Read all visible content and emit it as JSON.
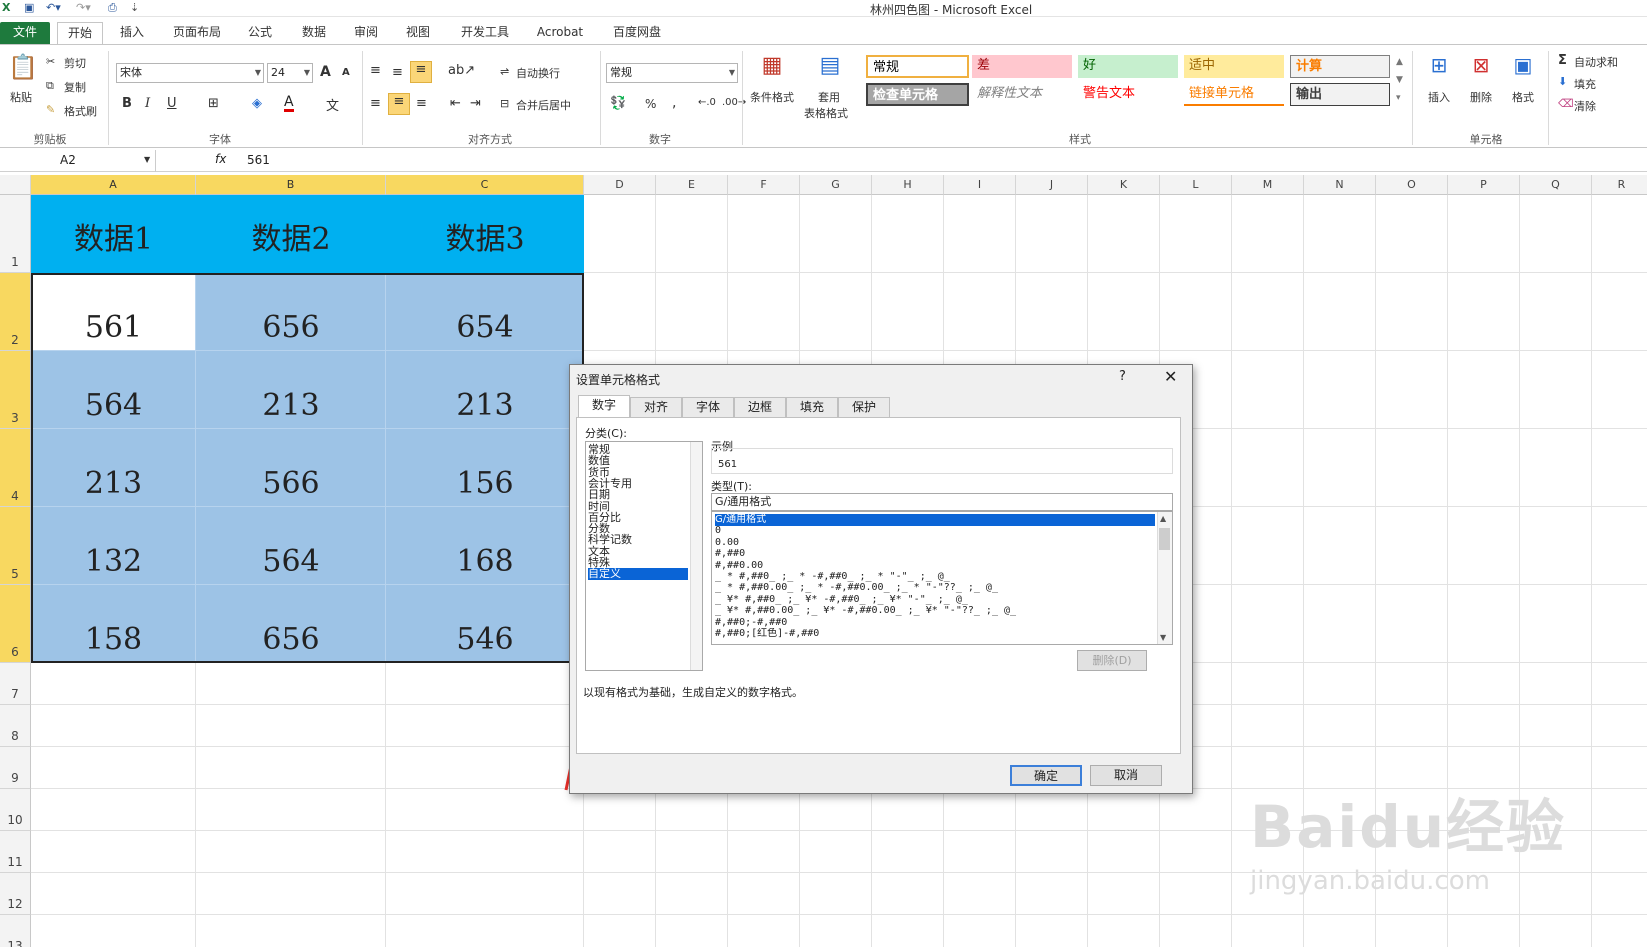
{
  "window": {
    "title": "林州四色图 - Microsoft Excel"
  },
  "tabs": [
    {
      "label": "文件"
    },
    {
      "label": "开始"
    },
    {
      "label": "插入"
    },
    {
      "label": "页面布局"
    },
    {
      "label": "公式"
    },
    {
      "label": "数据"
    },
    {
      "label": "审阅"
    },
    {
      "label": "视图"
    },
    {
      "label": "开发工具"
    },
    {
      "label": "Acrobat"
    },
    {
      "label": "百度网盘"
    }
  ],
  "ribbon": {
    "clipboard": {
      "paste": "粘贴",
      "cut": "剪切",
      "copy": "复制",
      "format_painter": "格式刷",
      "label": "剪贴板"
    },
    "font": {
      "name": "宋体",
      "size": "24",
      "label": "字体",
      "bold": "B",
      "italic": "I",
      "underline": "U",
      "grow": "A",
      "shrink": "A"
    },
    "align": {
      "wrap": "自动换行",
      "merge": "合并后居中",
      "label": "对齐方式"
    },
    "number": {
      "format": "常规",
      "label": "数字",
      "percent": "%",
      "comma": ","
    },
    "styles": {
      "conditional": "条件格式",
      "table_fmt_1": "套用",
      "table_fmt_2": "表格格式",
      "cells": [
        {
          "text": "常规",
          "bg": "#ffffff",
          "color": "#000000"
        },
        {
          "text": "差",
          "bg": "#ffc7ce",
          "color": "#9c0006"
        },
        {
          "text": "好",
          "bg": "#c6efce",
          "color": "#006100"
        },
        {
          "text": "适中",
          "bg": "#ffeb9c",
          "color": "#9c6500"
        },
        {
          "text": "计算",
          "bg": "#f2f2f2",
          "color": "#fa7d00"
        },
        {
          "text": "检查单元格",
          "bg": "#a5a5a5",
          "color": "#ffffff"
        },
        {
          "text": "解释性文本",
          "bg": "#ffffff",
          "color": "#7f7f7f"
        },
        {
          "text": "警告文本",
          "bg": "#ffffff",
          "color": "#ff0000"
        },
        {
          "text": "链接单元格",
          "bg": "#ffffff",
          "color": "#fa7d00"
        },
        {
          "text": "输出",
          "bg": "#f2f2f2",
          "color": "#3f3f3f"
        }
      ],
      "label": "样式"
    },
    "cells": {
      "insert": "插入",
      "delete": "删除",
      "format": "格式",
      "label": "单元格"
    },
    "editing": {
      "autosum": "自动求和",
      "fill": "填充",
      "clear": "清除"
    }
  },
  "formula_bar": {
    "name_box": "A2",
    "fx": "fx",
    "value": "561"
  },
  "sheet": {
    "columns": [
      "A",
      "B",
      "C",
      "D",
      "E",
      "F",
      "G",
      "H",
      "I",
      "J",
      "K",
      "L",
      "M",
      "N",
      "O",
      "P",
      "Q",
      "R"
    ],
    "rows": [
      "1",
      "2",
      "3",
      "4",
      "5",
      "6",
      "7",
      "8",
      "9",
      "10",
      "11",
      "12",
      "13"
    ],
    "header_cells": [
      "数据1",
      "数据2",
      "数据3"
    ],
    "data": [
      [
        "561",
        "656",
        "654"
      ],
      [
        "564",
        "213",
        "213"
      ],
      [
        "213",
        "566",
        "156"
      ],
      [
        "132",
        "564",
        "168"
      ],
      [
        "158",
        "656",
        "546"
      ]
    ],
    "colors": {
      "header_fill": "#00b0f0",
      "data_fill": "#9dc3e6"
    }
  },
  "dialog": {
    "title": "设置单元格格式",
    "help": "?",
    "close": "✕",
    "tabs": [
      "数字",
      "对齐",
      "字体",
      "边框",
      "填充",
      "保护"
    ],
    "category_label": "分类(C):",
    "categories": [
      "常规",
      "数值",
      "货币",
      "会计专用",
      "日期",
      "时间",
      "百分比",
      "分数",
      "科学记数",
      "文本",
      "特殊",
      "自定义"
    ],
    "selected_category": "自定义",
    "sample_label": "示例",
    "sample_value": "561",
    "type_label": "类型(T):",
    "type_value": "G/通用格式",
    "types": [
      "G/通用格式",
      "0",
      "0.00",
      "#,##0",
      "#,##0.00",
      "_ * #,##0_ ;_ * -#,##0_ ;_ * \"-\"_ ;_ @_",
      "_ * #,##0.00_ ;_ * -#,##0.00_ ;_ * \"-\"??_ ;_ @_",
      "_ ¥* #,##0_ ;_ ¥* -#,##0_ ;_ ¥* \"-\"_ ;_ @_",
      "_ ¥* #,##0.00_ ;_ ¥* -#,##0.00_ ;_ ¥* \"-\"??_ ;_ @_",
      "#,##0;-#,##0",
      "#,##0;[红色]-#,##0"
    ],
    "delete_btn": "删除(D)",
    "description": "以现有格式为基础，生成自定义的数字格式。",
    "ok": "确定",
    "cancel": "取消"
  },
  "watermark": {
    "brand": "Baidu经验",
    "url": "jingyan.baidu.com"
  }
}
